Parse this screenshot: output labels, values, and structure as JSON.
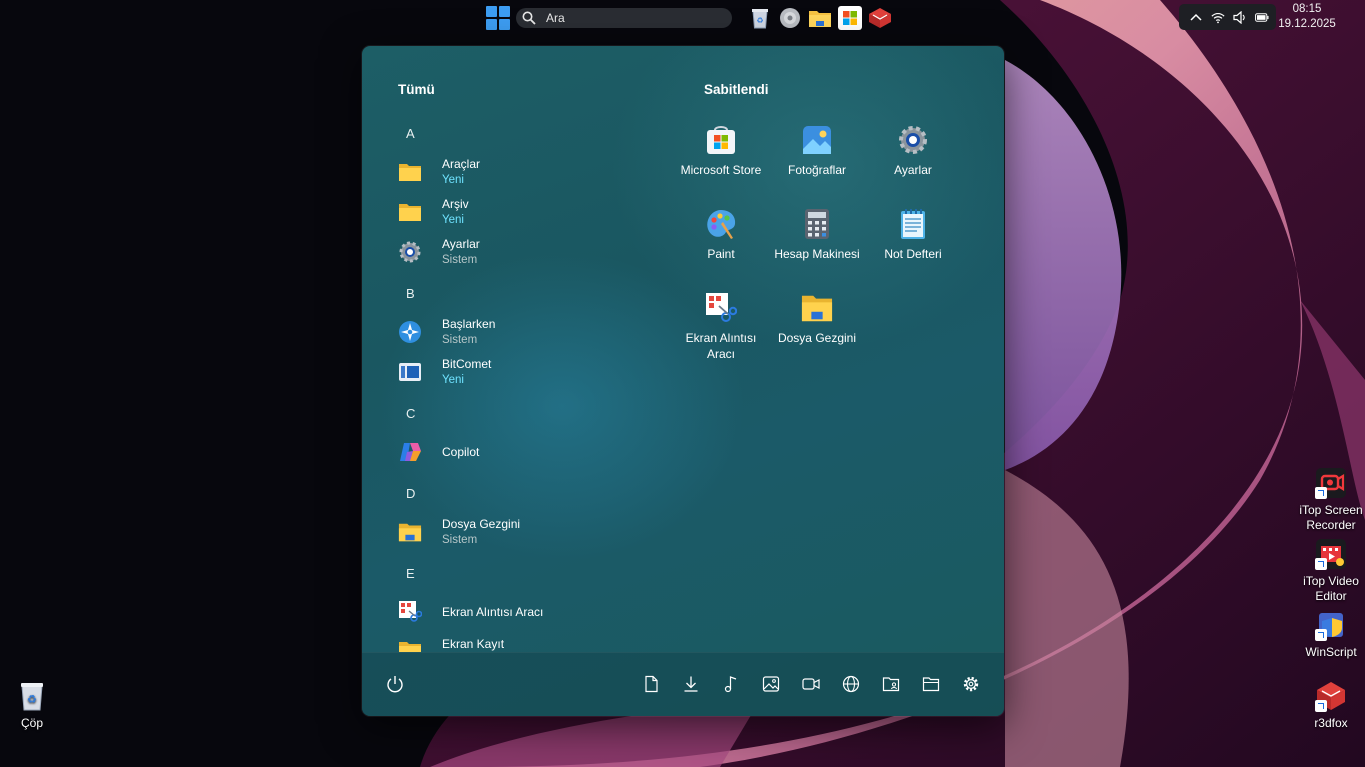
{
  "taskbar": {
    "search_placeholder": "Ara",
    "pinned": [
      "recycle-bin-icon",
      "disc-icon",
      "file-explorer-icon",
      "microsoft-store-icon",
      "r3dfox-icon"
    ]
  },
  "tray": {
    "time": "08:15",
    "date": "19.12.2025"
  },
  "start_menu": {
    "all_header": "Tümü",
    "pinned_header": "Sabitlendi",
    "all_apps": [
      {
        "type": "letter",
        "text": "A"
      },
      {
        "type": "app",
        "name": "Araçlar",
        "sub": "Yeni",
        "icon": "folder-icon",
        "expandable": true
      },
      {
        "type": "app",
        "name": "Arşiv",
        "sub": "Yeni",
        "icon": "folder-icon",
        "expandable": true
      },
      {
        "type": "app",
        "name": "Ayarlar",
        "sub": "Sistem",
        "icon": "gear-icon"
      },
      {
        "type": "letter",
        "text": "B"
      },
      {
        "type": "app",
        "name": "Başlarken",
        "sub": "Sistem",
        "icon": "get-started-icon"
      },
      {
        "type": "app",
        "name": "BitComet",
        "sub": "Yeni",
        "icon": "bitcomet-icon"
      },
      {
        "type": "letter",
        "text": "C"
      },
      {
        "type": "app",
        "name": "Copilot",
        "sub": "",
        "icon": "copilot-icon"
      },
      {
        "type": "letter",
        "text": "D"
      },
      {
        "type": "app",
        "name": "Dosya Gezgini",
        "sub": "Sistem",
        "icon": "file-explorer-icon"
      },
      {
        "type": "letter",
        "text": "E"
      },
      {
        "type": "app",
        "name": "Ekran Alıntısı Aracı",
        "sub": "",
        "icon": "snipping-tool-icon"
      },
      {
        "type": "app",
        "name": "Ekran Kayıt",
        "sub": "",
        "icon": "folder-icon"
      }
    ],
    "pinned": [
      {
        "name": "Microsoft Store",
        "icon": "microsoft-store-icon"
      },
      {
        "name": "Fotoğraflar",
        "icon": "photos-icon"
      },
      {
        "name": "Ayarlar",
        "icon": "gear-icon"
      },
      {
        "name": "Paint",
        "icon": "paint-icon"
      },
      {
        "name": "Hesap Makinesi",
        "icon": "calculator-icon"
      },
      {
        "name": "Not Defteri",
        "icon": "notepad-icon"
      },
      {
        "name": "Ekran Alıntısı Aracı",
        "icon": "snipping-tool-icon"
      },
      {
        "name": "Dosya Gezgini",
        "icon": "file-explorer-icon"
      }
    ],
    "footer_icons": [
      "documents-icon",
      "downloads-icon",
      "music-icon",
      "pictures-icon",
      "videos-icon",
      "network-icon",
      "personal-folder-icon",
      "file-explorer-icon",
      "settings-icon"
    ]
  },
  "desktop": {
    "left": [
      {
        "label": "Çöp",
        "icon": "recycle-bin-icon"
      }
    ],
    "right": [
      {
        "label": "iTop Screen Recorder",
        "icon": "itop-screen-recorder-icon"
      },
      {
        "label": "iTop Video Editor",
        "icon": "itop-video-editor-icon"
      },
      {
        "label": "WinScript",
        "icon": "winscript-icon"
      },
      {
        "label": "r3dfox",
        "icon": "r3dfox-icon"
      }
    ]
  }
}
